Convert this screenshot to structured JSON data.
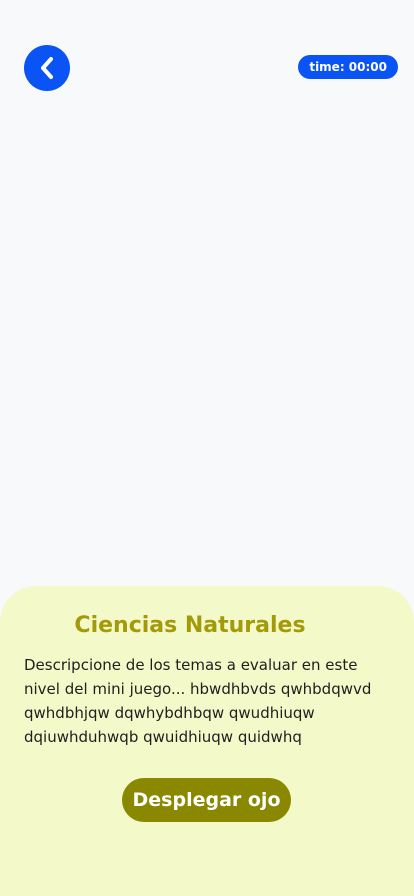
{
  "header": {
    "back_icon": "chevron-left-icon",
    "timer_text": "time: 00:00",
    "accent_color": "#0a53f5"
  },
  "sheet": {
    "title": "Ciencias Naturales",
    "description": "Descripcione de los temas a evaluar en este nivel del mini juego... hbwdhbvds qwhbdqwvd qwhdbhjqw dqwhybdhbqw qwudhiuqw dqiuwhduhwqb qwuidhiuqw quidwhq",
    "action_label": "Desplegar ojo",
    "background_color": "#f3f9c8",
    "title_color": "#a39a0a",
    "button_color": "#8a8700"
  }
}
